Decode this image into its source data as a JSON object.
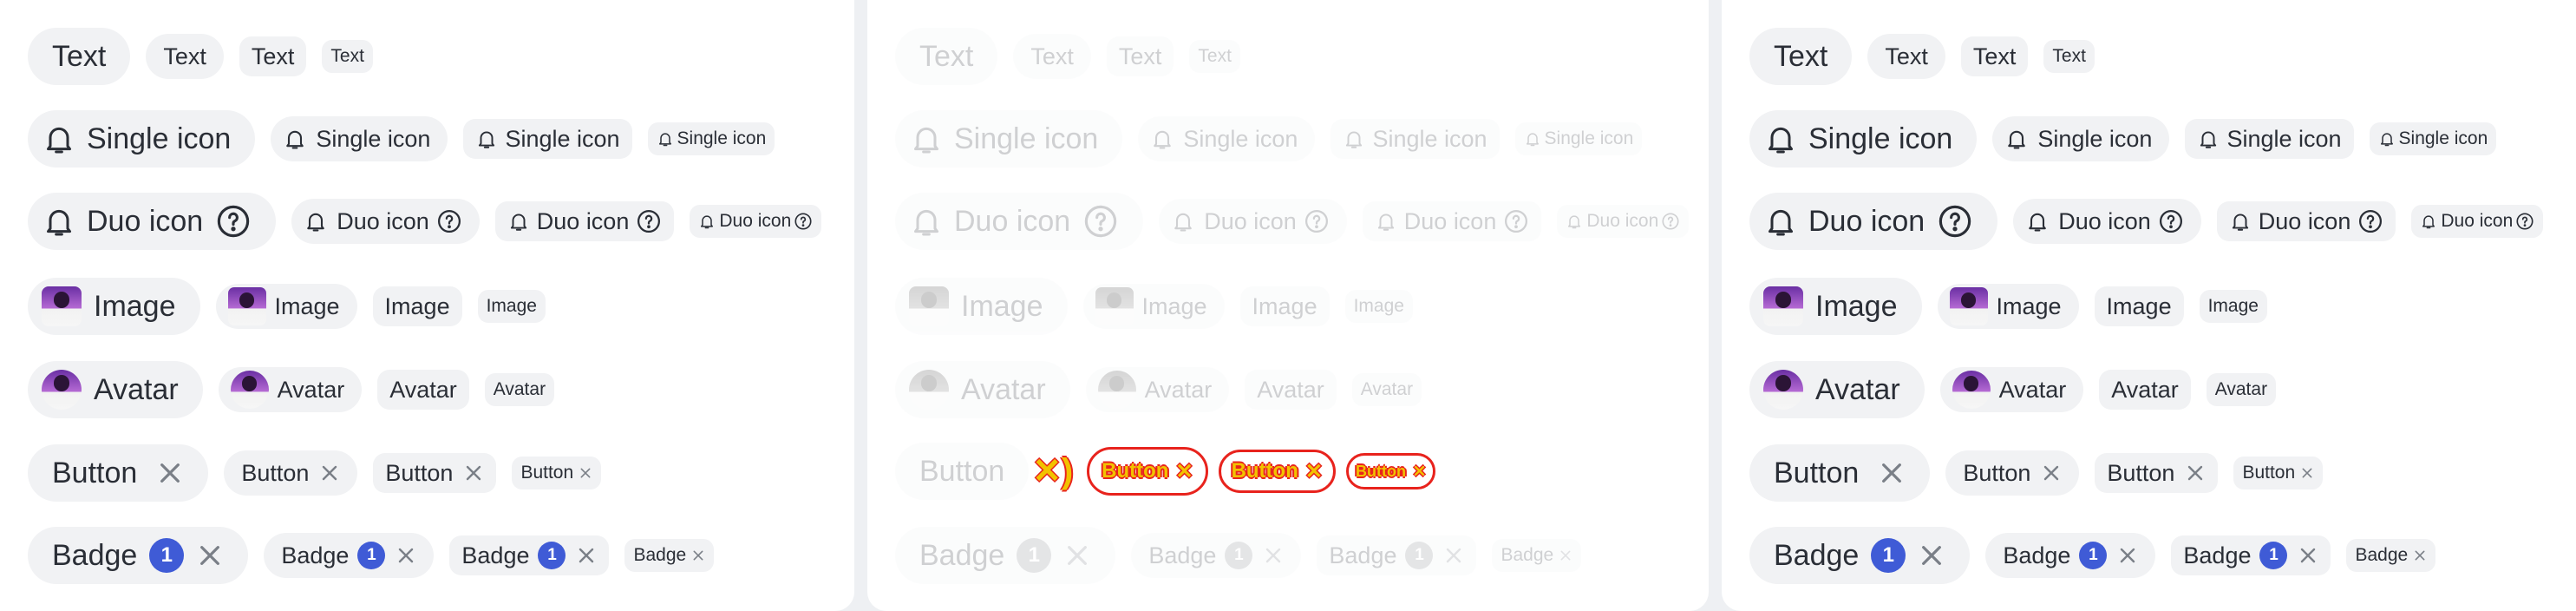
{
  "labels": {
    "text": "Text",
    "single_icon": "Single icon",
    "duo_icon": "Duo icon",
    "image": "Image",
    "avatar": "Avatar",
    "button": "Button",
    "badge": "Badge",
    "badge_count": "1"
  },
  "icons": {
    "leading": "bell-icon",
    "trailing_duo": "help-circle-icon",
    "remove": "close-icon"
  },
  "colors": {
    "chip_background": "#f1f2f4",
    "text": "#2a2e36",
    "badge_background": "#3f5bd6",
    "glitch_outline": "#e8231d",
    "glitch_fill": "#f2c200"
  },
  "panels": [
    "left",
    "middle",
    "right"
  ],
  "middle_panel_state": "disabled"
}
